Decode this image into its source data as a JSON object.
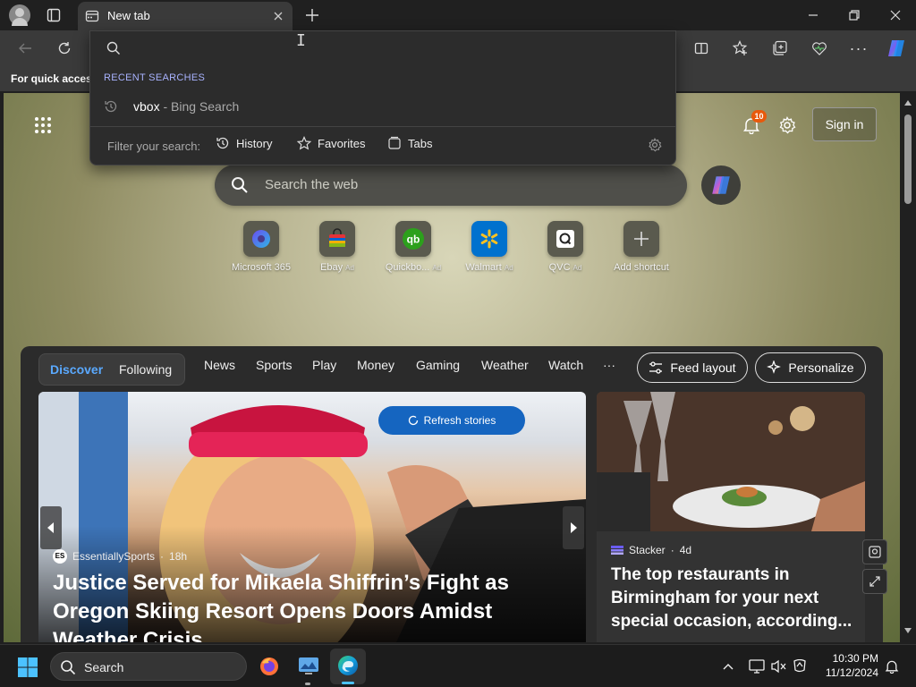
{
  "browser": {
    "tab_title": "New tab",
    "favorites_bar_text": "For quick access"
  },
  "dropdown": {
    "section_label": "RECENT SEARCHES",
    "recent_query": "vbox",
    "recent_suffix": " - Bing Search",
    "filter_label": "Filter your search:",
    "filters": [
      "History",
      "Favorites",
      "Tabs"
    ]
  },
  "newtab": {
    "notification_count": "10",
    "sign_in_label": "Sign in",
    "search_placeholder": "Search the web",
    "shortcuts": [
      {
        "label": "Microsoft 365",
        "ad": false
      },
      {
        "label": "Ebay",
        "ad": true
      },
      {
        "label": "Quickbo...",
        "ad": true
      },
      {
        "label": "Walmart",
        "ad": true
      },
      {
        "label": "QVC",
        "ad": true
      },
      {
        "label": "Add shortcut",
        "ad": false
      }
    ],
    "ad_label": "Ad"
  },
  "feed": {
    "toggle": [
      "Discover",
      "Following"
    ],
    "nav": [
      "News",
      "Sports",
      "Play",
      "Money",
      "Gaming",
      "Weather",
      "Watch",
      "···"
    ],
    "feed_layout_label": "Feed layout",
    "personalize_label": "Personalize",
    "refresh_label": "Refresh stories",
    "hero": {
      "source": "EssentiallySports",
      "source_initials": "ES",
      "age": "18h",
      "headline": "Justice Served for Mikaela Shiffrin’s Fight as Oregon Skiing Resort Opens Doors Amidst Weather Crisis"
    },
    "side": {
      "source": "Stacker",
      "age": "4d",
      "headline": "The top restaurants in Birmingham for your next special occasion, according..."
    }
  },
  "taskbar": {
    "search_label": "Search",
    "time": "10:30 PM",
    "date": "11/12/2024"
  },
  "colors": {
    "accent": "#0078d4",
    "refresh_blue": "#1565c0",
    "badge": "#e8590c"
  }
}
